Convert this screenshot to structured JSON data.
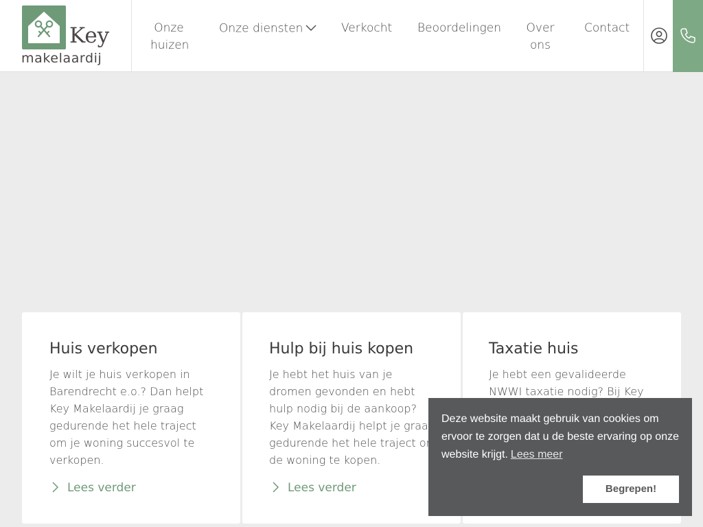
{
  "logo": {
    "name": "Key",
    "sub": "makelaardij",
    "mark_icon": "house-with-keys-icon",
    "brand_color": "#6e9a78"
  },
  "nav": {
    "items": [
      {
        "label": "Onze\nhuizen"
      },
      {
        "label": "Onze diensten"
      },
      {
        "label": "Verkocht"
      },
      {
        "label": "Beoordelingen"
      },
      {
        "label": "Over\nons"
      },
      {
        "label": "Contact"
      }
    ],
    "user_icon": "user-circle-icon",
    "phone_icon": "phone-icon",
    "accent_color": "#7ea985"
  },
  "cards": [
    {
      "title": "Huis verkopen",
      "text": "Je wilt je huis verkopen in Barendrecht e.o.? Dan helpt Key Makelaardij je graag gedurende het hele traject om je woning succesvol te verkopen.",
      "link": "Lees verder"
    },
    {
      "title": "Hulp bij huis kopen",
      "text": "Je hebt het huis van je dromen gevonden en hebt hulp nodig bij de aankoop? Key Makelaardij helpt je graag gedurende het hele traject om de woning te kopen.",
      "link": "Lees verder"
    },
    {
      "title": "Taxatie huis",
      "text": "Je hebt een gevalideerde NWWI taxatie nodig? Bij Key",
      "link": ""
    }
  ],
  "cookie": {
    "message": "Deze website maakt gebruik van cookies om ervoor te zorgen dat u de beste ervaring op onze website krijgt.",
    "link": "Lees meer",
    "button": "Begrepen!",
    "bg_color": "#58595b"
  }
}
